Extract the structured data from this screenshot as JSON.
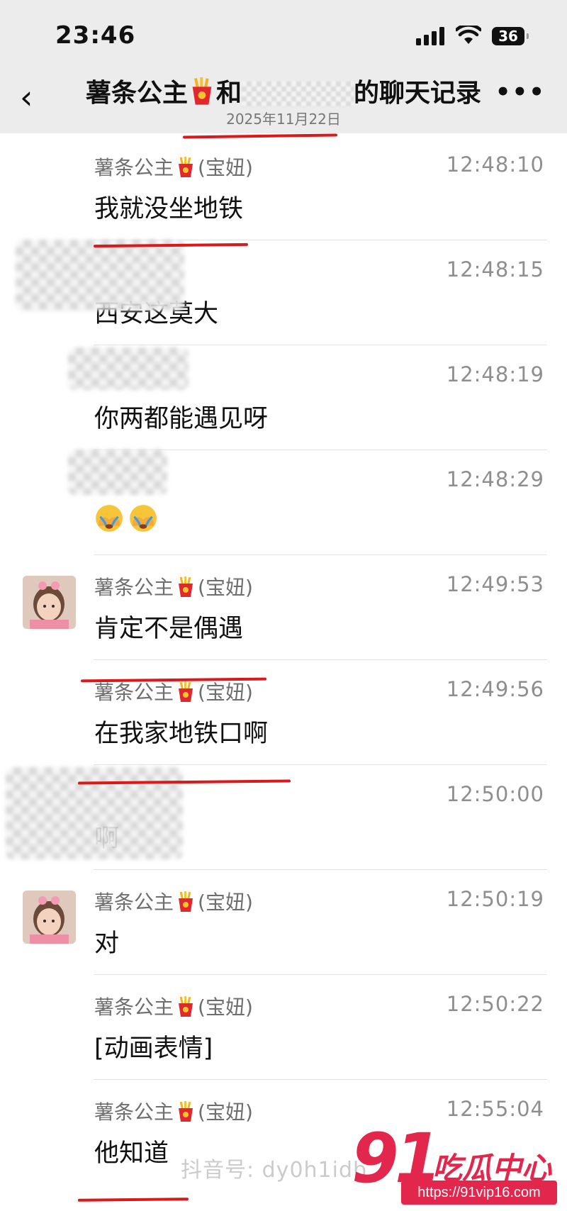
{
  "status_bar": {
    "time": "23:46",
    "battery": "36"
  },
  "header": {
    "title_prefix": "薯条公主",
    "title_mid": "和",
    "title_suffix": "的聊天记录",
    "date": "2025年11月22日"
  },
  "messages": [
    {
      "sender": "薯条公主",
      "sender_note": "(宝妞)",
      "time": "12:48:10",
      "text": "我就没坐地铁"
    },
    {
      "sender": "",
      "sender_note": "",
      "time": "12:48:15",
      "text": "西安这莫大"
    },
    {
      "sender": "",
      "sender_note": "",
      "time": "12:48:19",
      "text": "你两都能遇见呀"
    },
    {
      "sender": "",
      "sender_note": "",
      "time": "12:48:29",
      "text": ""
    },
    {
      "sender": "薯条公主",
      "sender_note": "(宝妞)",
      "time": "12:49:53",
      "text": "肯定不是偶遇"
    },
    {
      "sender": "薯条公主",
      "sender_note": "(宝妞)",
      "time": "12:49:56",
      "text": "在我家地铁口啊"
    },
    {
      "sender": "",
      "sender_note": "",
      "time": "12:50:00",
      "text": "啊"
    },
    {
      "sender": "薯条公主",
      "sender_note": "(宝妞)",
      "time": "12:50:19",
      "text": "对"
    },
    {
      "sender": "薯条公主",
      "sender_note": "(宝妞)",
      "time": "12:50:22",
      "text": "[动画表情]"
    },
    {
      "sender": "薯条公主",
      "sender_note": "(宝妞)",
      "time": "12:55:04",
      "text": "他知道"
    }
  ],
  "icons": {
    "sender_emoji": "french-fries-icon",
    "reaction_emoji": "facepalm-crying-emoji"
  },
  "watermark": {
    "text": "抖音号: dy0h1idb"
  },
  "logo": {
    "number": "91",
    "name": "吃瓜中心",
    "url": "https://91vip16.com"
  },
  "colors": {
    "underline": "#d9191b",
    "logo": "#e2264c"
  }
}
